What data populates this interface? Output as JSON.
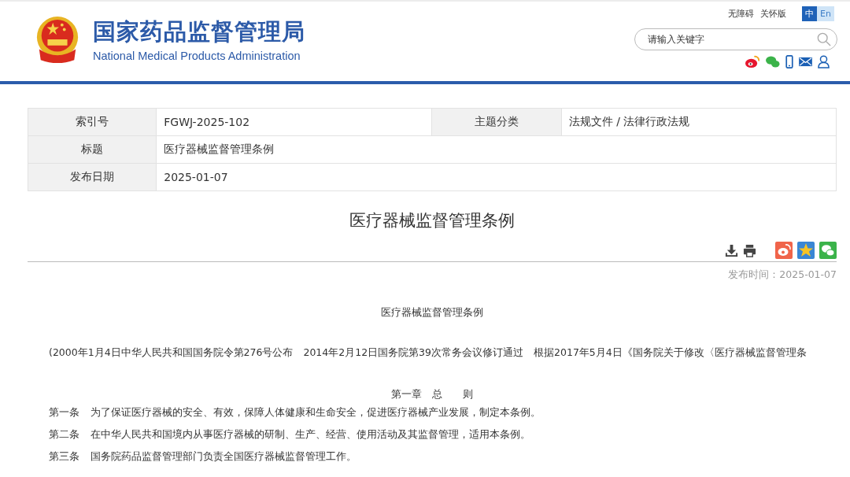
{
  "header": {
    "title": "国家药品监督管理局",
    "subtitle": "National Medical Products Administration",
    "top_links": [
      "无障碍",
      "关怀版"
    ],
    "languages": [
      {
        "label": "中",
        "selected": true
      },
      {
        "label": "En",
        "selected": false
      }
    ],
    "search": {
      "placeholder": "请输入关键字"
    }
  },
  "info_table": {
    "rows": [
      [
        {
          "label": "索引号",
          "value": "FGWJ-2025-102"
        },
        {
          "label": "主题分类",
          "value": "法规文件 / 法律行政法规"
        }
      ],
      [
        {
          "label": "标题",
          "value": "医疗器械监督管理条例"
        }
      ],
      [
        {
          "label": "发布日期",
          "value": "2025-01-07"
        }
      ]
    ]
  },
  "article": {
    "title": "医疗器械监督管理条例",
    "publish_time": "发布时间：2025-01-07",
    "doc_title": "医疗器械监督管理条例",
    "preamble": "(2000年1月4日中华人民共和国国务院令第276号公布　2014年2月12日国务院第39次常务会议修订通过　根据2017年5月4日《国务院关于修改〈医疗器械监督管理条",
    "chapter": "第一章　总　　则",
    "articles": [
      {
        "number": "第一条",
        "text": "为了保证医疗器械的安全、有效，保障人体健康和生命安全，促进医疗器械产业发展，制定本条例。"
      },
      {
        "number": "第二条",
        "text": "在中华人民共和国境内从事医疗器械的研制、生产、经营、使用活动及其监督管理，适用本条例。"
      },
      {
        "number": "第三条",
        "text": "国务院药品监督管理部门负责全国医疗器械监督管理工作。"
      }
    ]
  }
}
